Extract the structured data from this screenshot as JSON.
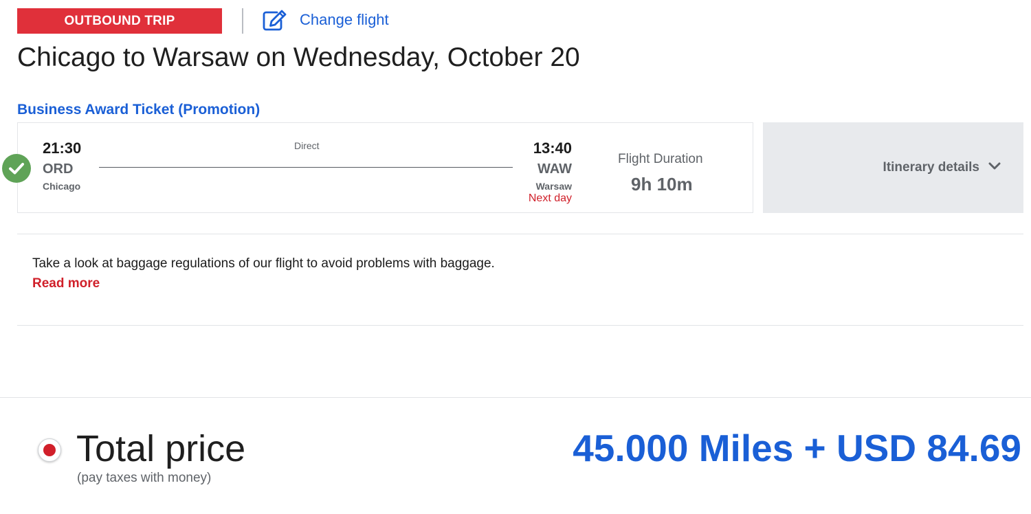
{
  "header": {
    "trip_badge": "OUTBOUND TRIP",
    "change_flight_label": "Change flight",
    "change_flight_icon": "edit-icon",
    "route_title": "Chicago to Warsaw on Wednesday, October 20"
  },
  "fare": {
    "ticket_type": "Business Award Ticket (Promotion)"
  },
  "flight": {
    "selected_icon": "check-circle-icon",
    "departure": {
      "time": "21:30",
      "code": "ORD",
      "city": "Chicago"
    },
    "arrival": {
      "time": "13:40",
      "code": "WAW",
      "city": "Warsaw",
      "day_note": "Next day"
    },
    "stops": "Direct",
    "duration_label": "Flight Duration",
    "duration": "9h 10m",
    "itinerary_label": "Itinerary details",
    "itinerary_icon": "chevron-down-icon"
  },
  "baggage": {
    "text": "Take a look at baggage regulations of our flight to avoid problems with baggage.",
    "link": "Read more"
  },
  "total": {
    "label": "Total price",
    "sublabel": "(pay taxes with money)",
    "amount": "45.000 Miles + USD 84.69"
  },
  "colors": {
    "brand_red": "#e0303a",
    "link_blue": "#1a5fd6",
    "check_green": "#5fa357",
    "muted_gray": "#5f6368",
    "panel_gray": "#e8eaed"
  }
}
